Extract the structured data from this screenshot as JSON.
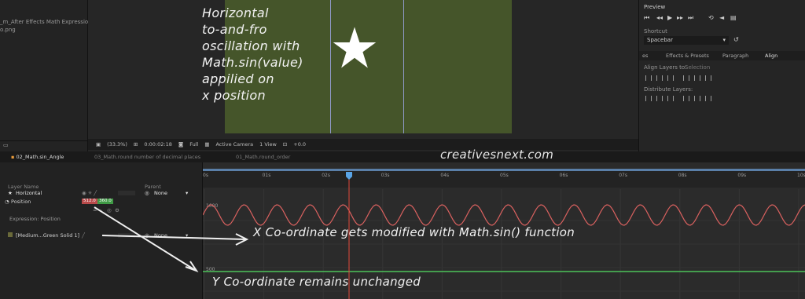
{
  "project_panel": {
    "files": [
      "_m_After Effects Math Expressions",
      "o.png"
    ]
  },
  "viewer": {
    "annotation_lines": [
      "Horizontal",
      "to-and-fro",
      "oscillation with",
      "Math.sin(value)",
      "appilied on",
      "x position"
    ],
    "zoom": "(33.3%)",
    "timecode": "0:00:02:18",
    "resolution": "Full",
    "camera": "Active Camera",
    "views": "1 View",
    "exposure": "+0.0",
    "solid_color": "#45552a"
  },
  "right_panel": {
    "preview_title": "Preview",
    "shortcut_label": "Shortcut",
    "shortcut_value": "Spacebar",
    "tabs": [
      "es",
      "Effects & Presets",
      "Paragraph",
      "Align"
    ],
    "align_layers_label": "Align Layers to:",
    "align_layers_value": "Selection",
    "distribute_label": "Distribute Layers:"
  },
  "comp_tabs": [
    "02_Math.sin_Angle",
    "03_Math.round number of decimal places",
    "01_Math.round_order"
  ],
  "watermark": "creativesnext.com",
  "layers": {
    "header_layer": "Layer Name",
    "header_parent": "Parent",
    "layer1_name": "Horizontal",
    "layer1_parent": "None",
    "property_name": "Position",
    "pos_x": "512.0",
    "pos_y": "360.0",
    "expression_label": "Expression: Position",
    "layer2_name": "[Medium...Green Solid 1]",
    "layer2_parent": "None"
  },
  "timeline": {
    "ruler_labels": [
      "0s",
      "01s",
      "02s",
      "03s",
      "04s",
      "05s",
      "06s",
      "07s",
      "08s",
      "09s",
      "10s"
    ],
    "graph_label_x": "1000",
    "graph_label_y": "500",
    "x_color": "#d9615f",
    "y_color": "#4cc35a",
    "playhead_color": "#e34a3b",
    "note_x": "X Co-ordinate gets modified with Math.sin() function",
    "note_y": "Y Co-ordinate remains unchanged"
  }
}
